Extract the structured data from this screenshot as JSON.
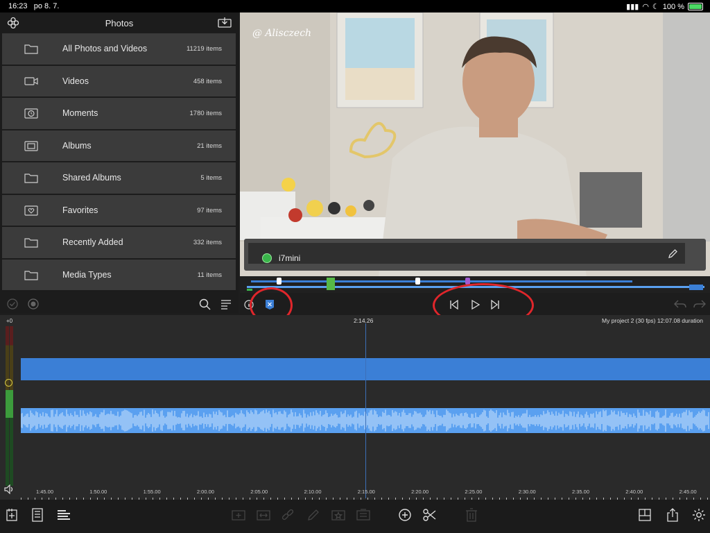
{
  "status": {
    "time": "16:23",
    "date": "po 8. 7.",
    "battery": "100 %"
  },
  "library": {
    "title": "Photos",
    "rows": [
      {
        "icon": "folder-icon",
        "label": "All Photos and Videos",
        "count": "11219 items"
      },
      {
        "icon": "video-camera-icon",
        "label": "Videos",
        "count": "458 items"
      },
      {
        "icon": "moments-icon",
        "label": "Moments",
        "count": "1780 items"
      },
      {
        "icon": "albums-icon",
        "label": "Albums",
        "count": "21 items"
      },
      {
        "icon": "folder-icon",
        "label": "Shared Albums",
        "count": "5 items"
      },
      {
        "icon": "heart-icon",
        "label": "Favorites",
        "count": "97 items"
      },
      {
        "icon": "folder-icon",
        "label": "Recently Added",
        "count": "332 items"
      },
      {
        "icon": "folder-icon",
        "label": "Media Types",
        "count": "11 items"
      }
    ]
  },
  "preview": {
    "watermark": "@ Alisczech",
    "clip_name": "i7mini"
  },
  "timeline": {
    "timecode": "2:14.26",
    "project": "My project 2 (30 fps)  12:07.08 duration",
    "gain": "+0",
    "ticks": [
      "1:45.00",
      "1:50.00",
      "1:55.00",
      "2:00.00",
      "2:05.00",
      "2:10.00",
      "2:15.00",
      "2:20.00",
      "2:25.00",
      "2:30.00",
      "2:35.00",
      "2:40.00",
      "2:45.00"
    ]
  },
  "colors": {
    "accent": "#3b7fd6",
    "audio": "#5aa0f0",
    "annotation": "#e0262b",
    "clip_dot": "#39b54a"
  }
}
